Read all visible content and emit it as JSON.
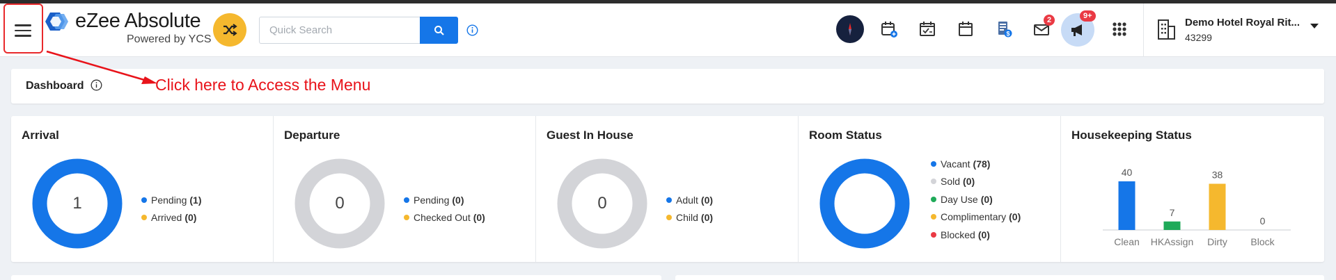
{
  "header": {
    "brand": "eZee Absolute",
    "brand_sub": "Powered by YCS",
    "search_placeholder": "Quick Search",
    "icons": [
      "menu-icon",
      "shuffle-icon",
      "search-icon",
      "info-icon",
      "compass-icon",
      "reservation-calendar-icon",
      "task-calendar-icon",
      "calendar-icon",
      "billing-icon",
      "mail-icon",
      "announcement-icon",
      "apps-grid-icon",
      "hotel-building-icon"
    ],
    "mail_badge": "2",
    "announce_badge": "9+",
    "hotel_name": "Demo Hotel Royal Rit...",
    "hotel_code": "43299"
  },
  "dashbar": {
    "title": "Dashboard"
  },
  "annotation": {
    "text": "Click here to Access the Menu",
    "color": "#e8131a"
  },
  "colors": {
    "accent": "#1576e8",
    "yellow": "#f5b82e",
    "grey": "#d3d4d8",
    "green": "#1faa59",
    "red": "#ea3a44"
  },
  "cards": [
    {
      "title": "Arrival",
      "center": "1",
      "ring": "blue",
      "legend": [
        {
          "label": "Pending",
          "value": "(1)",
          "color": "#1576e8"
        },
        {
          "label": "Arrived",
          "value": "(0)",
          "color": "#f5b82e"
        }
      ]
    },
    {
      "title": "Departure",
      "center": "0",
      "ring": "grey",
      "legend": [
        {
          "label": "Pending",
          "value": "(0)",
          "color": "#1576e8"
        },
        {
          "label": "Checked Out",
          "value": "(0)",
          "color": "#f5b82e"
        }
      ]
    },
    {
      "title": "Guest In House",
      "center": "0",
      "ring": "grey",
      "legend": [
        {
          "label": "Adult",
          "value": "(0)",
          "color": "#1576e8"
        },
        {
          "label": "Child",
          "value": "(0)",
          "color": "#f5b82e"
        }
      ]
    },
    {
      "title": "Room Status",
      "center": "",
      "ring": "blue",
      "legend": [
        {
          "label": "Vacant",
          "value": "(78)",
          "color": "#1576e8"
        },
        {
          "label": "Sold",
          "value": "(0)",
          "color": "#d3d4d8"
        },
        {
          "label": "Day Use",
          "value": "(0)",
          "color": "#1faa59"
        },
        {
          "label": "Complimentary",
          "value": "(0)",
          "color": "#f5b82e"
        },
        {
          "label": "Blocked",
          "value": "(0)",
          "color": "#ea3a44"
        }
      ]
    },
    {
      "title": "Housekeeping Status"
    }
  ],
  "chart_data": {
    "type": "bar",
    "categories": [
      "Clean",
      "HKAssign",
      "Dirty",
      "Block"
    ],
    "values": [
      40,
      7,
      38,
      0
    ],
    "colors": [
      "#1576e8",
      "#1faa59",
      "#f5b82e",
      "#d3d4d8"
    ],
    "title": "Housekeeping Status",
    "ylim": [
      0,
      40
    ],
    "grid": false
  }
}
